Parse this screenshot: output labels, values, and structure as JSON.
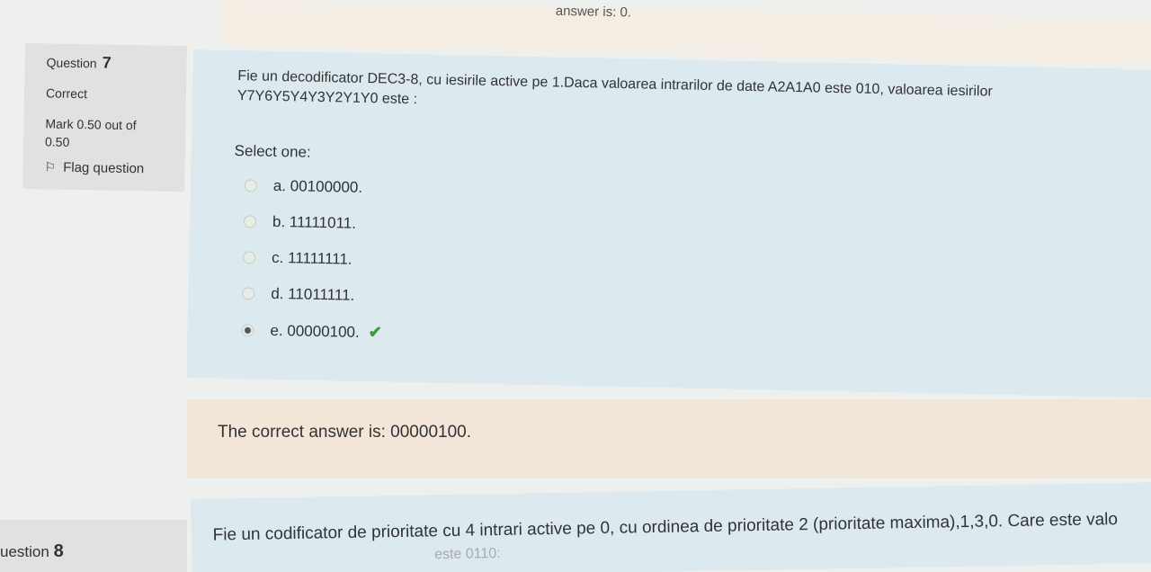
{
  "prev_question": {
    "answer_tail": "answer is: 0."
  },
  "q7": {
    "label": "Question",
    "number": "7",
    "status": "Correct",
    "mark_line1": "Mark 0.50 out of",
    "mark_line2": "0.50",
    "flag_label": "Flag question",
    "text_line1": "Fie un decodificator DEC3-8, cu iesirile active pe 1.Daca valoarea intrarilor de date A2A1A0 este 010, valoarea iesirilor",
    "text_line2": "Y7Y6Y5Y4Y3Y2Y1Y0 este :",
    "select_one": "Select one:",
    "options": [
      {
        "label": "a. 00100000.",
        "selected": false
      },
      {
        "label": "b. 11111011.",
        "selected": false
      },
      {
        "label": "c. 11111111.",
        "selected": false
      },
      {
        "label": "d. 11011111.",
        "selected": false
      },
      {
        "label": "e. 00000100.",
        "selected": true
      }
    ],
    "correct_icon": "check-icon",
    "feedback": "The correct answer is: 00000100."
  },
  "q8": {
    "label": "uestion",
    "number": "8",
    "text": "Fie un codificator de prioritate cu 4 intrari active pe 0, cu ordinea de prioritate 2 (prioritate maxima),1,3,0. Care este valo",
    "text_line2": "este 0110:"
  },
  "colors": {
    "info_bg": "#dfe2df",
    "question_bg": "#dceaf0",
    "feedback_bg": "#f1e6d8",
    "check": "#3a9c3a"
  }
}
